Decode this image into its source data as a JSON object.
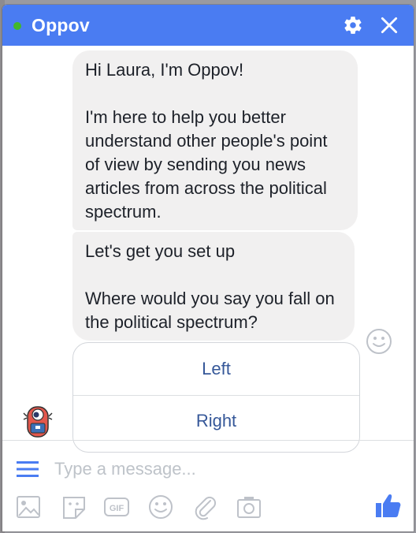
{
  "chat": {
    "title": "Oppov",
    "status_color": "#42b72a",
    "header_color": "#4a7cf2"
  },
  "messages": [
    {
      "lines": [
        "Hi Laura, I'm Oppov!",
        "I'm here to help you better understand other people's point of view by sending you news articles from across the political spectrum."
      ]
    },
    {
      "lines": [
        "Let's get you set up",
        "Where would you say you fall on the political spectrum?"
      ]
    }
  ],
  "quick_replies": [
    "Left",
    "Right"
  ],
  "composer": {
    "placeholder": "Type a message..."
  },
  "toolbar_icons": [
    "photo-icon",
    "sticker-icon",
    "gif-icon",
    "emoji-icon",
    "attachment-icon",
    "camera-icon",
    "like-icon"
  ],
  "gif_label": "GIF"
}
